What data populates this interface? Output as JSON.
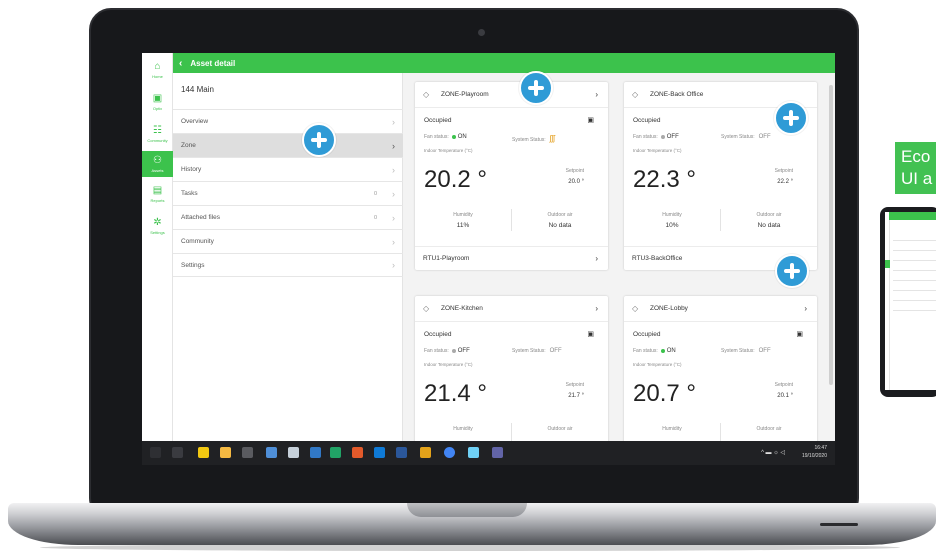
{
  "app": {
    "header_title": "Asset detail",
    "asset_name": "144 Main"
  },
  "rail": [
    {
      "label": "Home",
      "icon": "home-icon"
    },
    {
      "label": "Optix",
      "icon": "optix-icon"
    },
    {
      "label": "Community",
      "icon": "community-icon"
    },
    {
      "label": "Assets",
      "icon": "assets-icon"
    },
    {
      "label": "Reports",
      "icon": "reports-icon"
    },
    {
      "label": "Settings",
      "icon": "settings-icon"
    }
  ],
  "sidebar": {
    "items": [
      {
        "label": "Overview",
        "count": ""
      },
      {
        "label": "Zone",
        "count": ""
      },
      {
        "label": "History",
        "count": ""
      },
      {
        "label": "Tasks",
        "count": "0"
      },
      {
        "label": "Attached files",
        "count": "0"
      },
      {
        "label": "Community",
        "count": ""
      },
      {
        "label": "Settings",
        "count": ""
      }
    ],
    "active_index": 1
  },
  "labels": {
    "fan_status": "Fan status:",
    "system_status": "System Status:",
    "indoor_temp": "Indoor Temperature (°C)",
    "setpoint": "Setpoint",
    "humidity": "Humidity",
    "outdoor_air": "Outdoor air"
  },
  "zones": [
    {
      "name": "ZONE-Playroom",
      "occupancy": "Occupied",
      "fan": "ON",
      "fan_color": "#3cc24c",
      "system": "",
      "system_icon": "heating-icon",
      "temperature": "20.2 °",
      "setpoint": "20.0 °",
      "humidity": "11%",
      "outdoor": "No data",
      "equipment": "RTU1-Playroom"
    },
    {
      "name": "ZONE-Back Office",
      "occupancy": "Occupied",
      "fan": "OFF",
      "fan_color": "#aaaaaa",
      "system": "OFF",
      "temperature": "22.3 °",
      "setpoint": "22.2 °",
      "humidity": "10%",
      "outdoor": "No data",
      "equipment": "RTU3-BackOffice"
    },
    {
      "name": "ZONE-Kitchen",
      "occupancy": "Occupied",
      "fan": "OFF",
      "fan_color": "#aaaaaa",
      "system": "OFF",
      "temperature": "21.4 °",
      "setpoint": "21.7 °",
      "humidity": "",
      "outdoor": ""
    },
    {
      "name": "ZONE-Lobby",
      "occupancy": "Occupied",
      "fan": "ON",
      "fan_color": "#3cc24c",
      "system": "OFF",
      "temperature": "20.7 °",
      "setpoint": "20.1 °",
      "humidity": "",
      "outdoor": ""
    }
  ],
  "taskbar": {
    "time": "16:47",
    "date": "19/10/2020"
  },
  "eco_label": "Eco\nUI a",
  "colors": {
    "brand_green": "#3cc24c",
    "callout_blue": "#2f9bd6",
    "heat_orange": "#e39c17"
  }
}
